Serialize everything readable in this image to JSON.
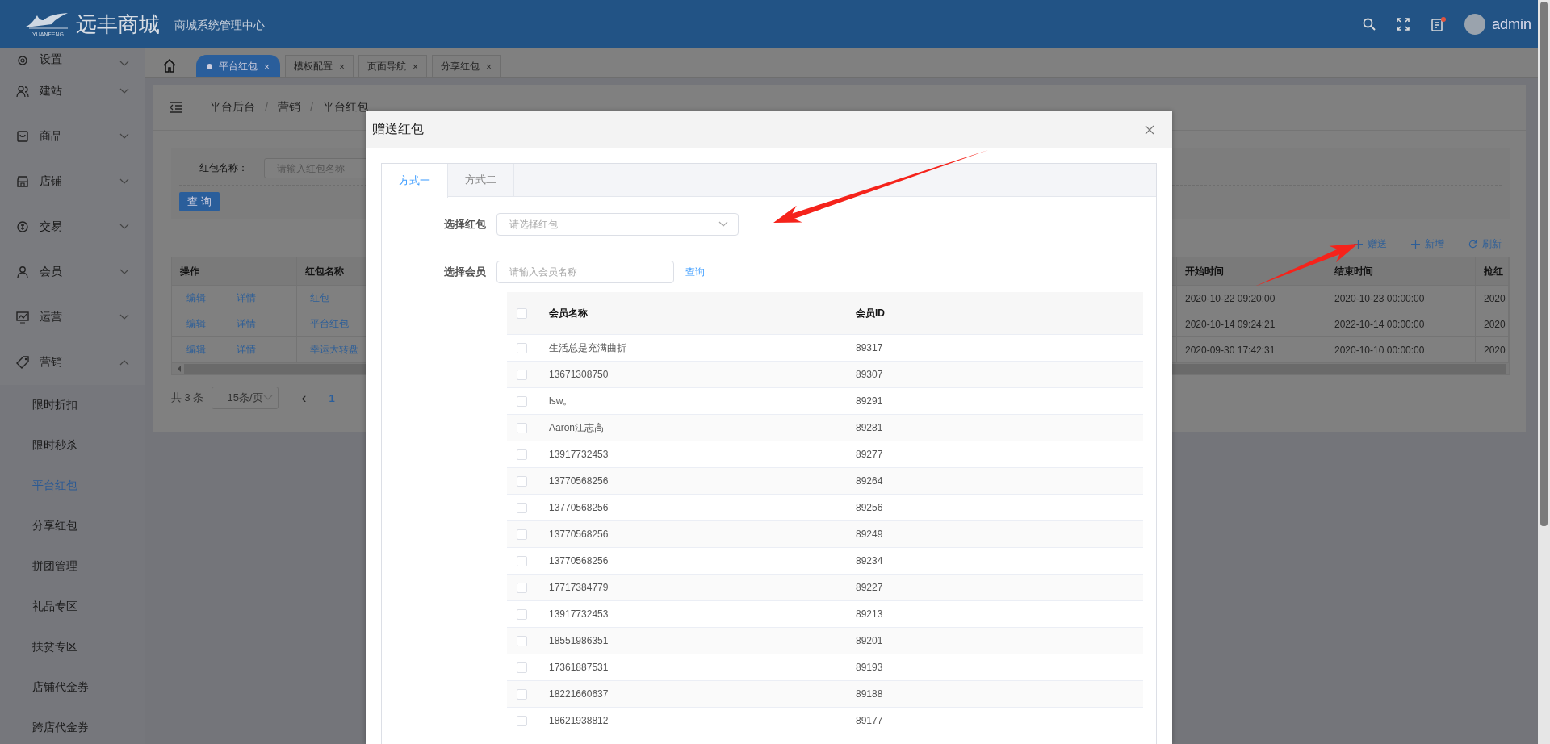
{
  "header": {
    "logo_caption": "YUANFENG",
    "title": "远丰商城",
    "subtitle": "商城系统管理中心",
    "user": "admin",
    "has_notification": true
  },
  "sidebar": {
    "items": [
      {
        "label": "设置",
        "expanded": false
      },
      {
        "label": "建站",
        "expanded": false
      },
      {
        "label": "商品",
        "expanded": false
      },
      {
        "label": "店铺",
        "expanded": false
      },
      {
        "label": "交易",
        "expanded": false
      },
      {
        "label": "会员",
        "expanded": false
      },
      {
        "label": "运营",
        "expanded": false
      },
      {
        "label": "营销",
        "expanded": true,
        "children": [
          {
            "label": "限时折扣",
            "selected": false
          },
          {
            "label": "限时秒杀",
            "selected": false
          },
          {
            "label": "平台红包",
            "selected": true
          },
          {
            "label": "分享红包",
            "selected": false
          },
          {
            "label": "拼团管理",
            "selected": false
          },
          {
            "label": "礼品专区",
            "selected": false
          },
          {
            "label": "扶贫专区",
            "selected": false
          },
          {
            "label": "店铺代金券",
            "selected": false
          },
          {
            "label": "跨店代金券",
            "selected": false
          }
        ]
      }
    ]
  },
  "tabs": [
    {
      "label": "平台红包",
      "selected": true,
      "close": "×"
    },
    {
      "label": "模板配置",
      "selected": false,
      "close": "×"
    },
    {
      "label": "页面导航",
      "selected": false,
      "close": "×"
    },
    {
      "label": "分享红包",
      "selected": false,
      "close": "×"
    }
  ],
  "breadcrumb": {
    "separator": "/",
    "items": [
      "平台后台",
      "营销",
      "平台红包"
    ]
  },
  "search": {
    "label": "红包名称：",
    "placeholder": "请输入红包名称",
    "button": "查 询"
  },
  "toolbar": [
    {
      "label": "赠送",
      "kind": "add"
    },
    {
      "label": "新增",
      "kind": "add"
    },
    {
      "label": "刷新",
      "kind": "refresh"
    }
  ],
  "table": {
    "columns": [
      "操作",
      "红包名称",
      "开始时间",
      "结束时间",
      "抢红"
    ],
    "rows": [
      {
        "actions": [
          "编辑",
          "详情"
        ],
        "name": "红包",
        "start": "2020-10-22 09:20:00",
        "end": "2020-10-23 00:00:00",
        "column_6": "2020"
      },
      {
        "actions": [
          "编辑",
          "详情"
        ],
        "name": "平台红包",
        "start": "2020-10-14 09:24:21",
        "end": "2022-10-14 00:00:00",
        "column_6": "2020"
      },
      {
        "actions": [
          "编辑",
          "详情"
        ],
        "name": "幸运大转盘",
        "start": "2020-09-30 17:42:31",
        "end": "2020-10-10 00:00:00",
        "column_6": "2020"
      }
    ]
  },
  "pagination": {
    "total": "共 3 条",
    "page_size": "15条/页",
    "prev": "‹",
    "pages": [
      {
        "label": "1",
        "selected": true
      }
    ]
  },
  "dialog": {
    "title": "赠送红包",
    "tabs": [
      {
        "label": "方式一",
        "selected": true
      },
      {
        "label": "方式二",
        "selected": false
      }
    ],
    "fields": [
      {
        "label": "选择红包",
        "kind": "select",
        "placeholder": "请选择红包"
      },
      {
        "label": "选择会员",
        "kind": "search",
        "placeholder": "请输入会员名称",
        "action": "查询"
      }
    ],
    "members": {
      "columns": [
        "会员名称",
        "会员ID"
      ],
      "all_checked": false,
      "rows": [
        {
          "name": "生活总是充满曲折",
          "id": "89317",
          "checked": false
        },
        {
          "name": "13671308750",
          "id": "89307",
          "checked": false
        },
        {
          "name": "lsw。",
          "id": "89291",
          "checked": false
        },
        {
          "name": "Aaron江志高",
          "id": "89281",
          "checked": false
        },
        {
          "name": "13917732453",
          "id": "89277",
          "checked": false
        },
        {
          "name": "13770568256",
          "id": "89264",
          "checked": false
        },
        {
          "name": "13770568256",
          "id": "89256",
          "checked": false
        },
        {
          "name": "13770568256",
          "id": "89249",
          "checked": false
        },
        {
          "name": "13770568256",
          "id": "89234",
          "checked": false
        },
        {
          "name": "17717384779",
          "id": "89227",
          "checked": false
        },
        {
          "name": "13917732453",
          "id": "89213",
          "checked": false
        },
        {
          "name": "18551986351",
          "id": "89201",
          "checked": false
        },
        {
          "name": "17361887531",
          "id": "89193",
          "checked": false
        },
        {
          "name": "18221660637",
          "id": "89188",
          "checked": false
        },
        {
          "name": "18621938812",
          "id": "89177",
          "checked": false
        }
      ]
    }
  }
}
